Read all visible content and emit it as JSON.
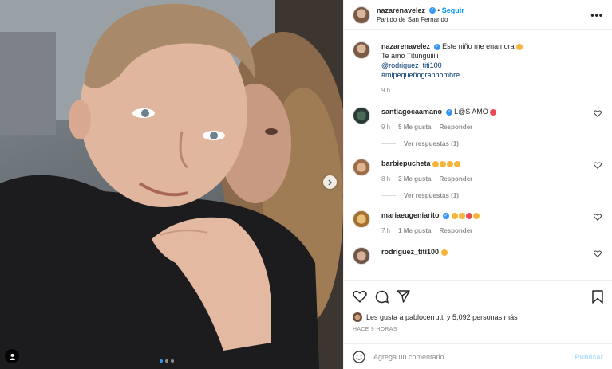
{
  "header": {
    "username": "nazarenavelez",
    "follow_label": "Seguir",
    "separator": "•",
    "location": "Partido de San Fernando",
    "more_label": "•••"
  },
  "caption": {
    "username": "nazarenavelez",
    "line1": "Este niño me enamora",
    "line2": "Te amo Titunguiiiii",
    "mention": "@rodriguez_titi100",
    "hashtag": "#mipequeñogranhombre",
    "time": "9 h"
  },
  "comments": [
    {
      "username": "santiagocaamano",
      "text": "L@S AMO",
      "time": "9 h",
      "likes": "5 Me gusta",
      "reply": "Responder",
      "view_replies": "Ver respuestas (1)"
    },
    {
      "username": "barbiepucheta",
      "text": "",
      "time": "8 h",
      "likes": "3 Me gusta",
      "reply": "Responder",
      "view_replies": "Ver respuestas (1)"
    },
    {
      "username": "mariaeugeniarito",
      "text": "",
      "time": "7 h",
      "likes": "1 Me gusta",
      "reply": "Responder"
    },
    {
      "username": "rodriguez_titi100",
      "text": ""
    }
  ],
  "likes_text": "Les gusta a pablocerrutti y 5,092 personas más",
  "time_ago": "HACE 9 HORAS",
  "add_comment": {
    "placeholder": "Agrega un comentario...",
    "publish_label": "Publicar"
  },
  "colors": {
    "accent": "#0095f6",
    "verified": "#3897f0",
    "muted": "#8e8e8e"
  }
}
